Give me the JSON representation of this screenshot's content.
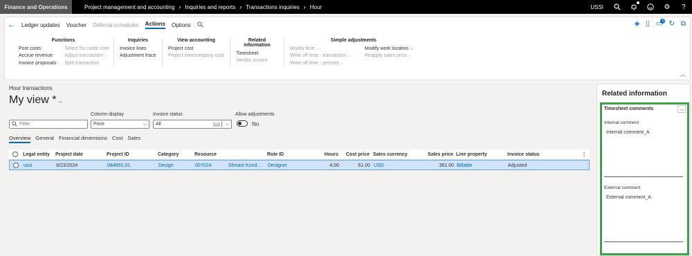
{
  "topbar": {
    "app_name": "Finance and Operations",
    "breadcrumbs": [
      "Project management and accounting",
      "Inquiries and reports",
      "Transactions inquiries",
      "Hour"
    ],
    "company": "USSI"
  },
  "actionpane": {
    "tabs": [
      {
        "label": "Ledger updates",
        "enabled": true
      },
      {
        "label": "Voucher",
        "enabled": true
      },
      {
        "label": "Deferral schedules",
        "enabled": false
      },
      {
        "label": "Actions",
        "enabled": true,
        "active": true
      },
      {
        "label": "Options",
        "enabled": true
      }
    ],
    "notification_count": "0",
    "groups": [
      {
        "title": "Functions",
        "cols": [
          [
            {
              "label": "Post costs",
              "enabled": true
            },
            {
              "label": "Accrue revenue",
              "enabled": true
            },
            {
              "label": "Invoice proposals",
              "enabled": true
            }
          ],
          [
            {
              "label": "Select for credit note",
              "enabled": false
            },
            {
              "label": "Adjust transaction",
              "enabled": false,
              "menu": true
            },
            {
              "label": "Split transaction",
              "enabled": false
            }
          ]
        ]
      },
      {
        "title": "Inquiries",
        "cols": [
          [
            {
              "label": "Invoice lines",
              "enabled": true
            },
            {
              "label": "Adjustment trace",
              "enabled": true
            }
          ]
        ]
      },
      {
        "title": "View accounting",
        "cols": [
          [
            {
              "label": "Project cost",
              "enabled": true
            },
            {
              "label": "Project intercompany cost",
              "enabled": false
            }
          ]
        ]
      },
      {
        "title": "Related information",
        "cols": [
          [
            {
              "label": "Timesheet",
              "enabled": true
            },
            {
              "label": "Vendor invoice",
              "enabled": false
            }
          ]
        ]
      },
      {
        "title": "Simple adjustments",
        "cols": [
          [
            {
              "label": "Modify time",
              "enabled": false,
              "menu": true
            },
            {
              "label": "Write off time - transaction",
              "enabled": false,
              "menu": true
            },
            {
              "label": "Write off time - percent",
              "enabled": false,
              "menu": true
            }
          ],
          [
            {
              "label": "Modify work location",
              "enabled": true,
              "menu": true
            },
            {
              "label": "Reapply sales price",
              "enabled": false,
              "menu": true
            }
          ]
        ]
      }
    ]
  },
  "main": {
    "caption": "Hour transactions",
    "view_name": "My view *",
    "filter_placeholder": "Filter",
    "column_display": {
      "label": "Column display",
      "value": "Price"
    },
    "invoice_status": {
      "label": "Invoice status",
      "value": "All"
    },
    "allow_adjustments": {
      "label": "Allow adjustments",
      "value": "No"
    },
    "subtabs": [
      "Overview",
      "General",
      "Financial dimensions",
      "Cost",
      "Sales"
    ],
    "grid": {
      "columns": [
        "Legal entity",
        "Project date",
        "Project ID",
        "Category",
        "Resource",
        "Role ID",
        "Hours",
        "Cost price",
        "Sales currency",
        "Sales price",
        "Line property",
        "Invoice status"
      ],
      "rows": [
        {
          "legal_entity": "ussi",
          "project_date": "9/23/2024",
          "project_id": "084991.01",
          "category": "Design",
          "resource": "007024",
          "resource_name": "Shivani Kund...",
          "role_id": "Designer",
          "hours": "4.00",
          "cost_price": "61.00",
          "sales_currency": "USD",
          "sales_price": "361.00",
          "line_property": "Billable",
          "invoice_status": "Adjusted"
        }
      ]
    }
  },
  "related": {
    "title": "Related information",
    "section_title": "Timesheet comments",
    "internal_label": "Internal comment",
    "internal_value": "Internal comment_A",
    "external_label": "External comment",
    "external_value": "External comment_A",
    "highlight_color": "#3da34a"
  },
  "colors": {
    "accent": "#0067b8",
    "selected_row": "#cfe4fa",
    "topbar": "#000000"
  }
}
